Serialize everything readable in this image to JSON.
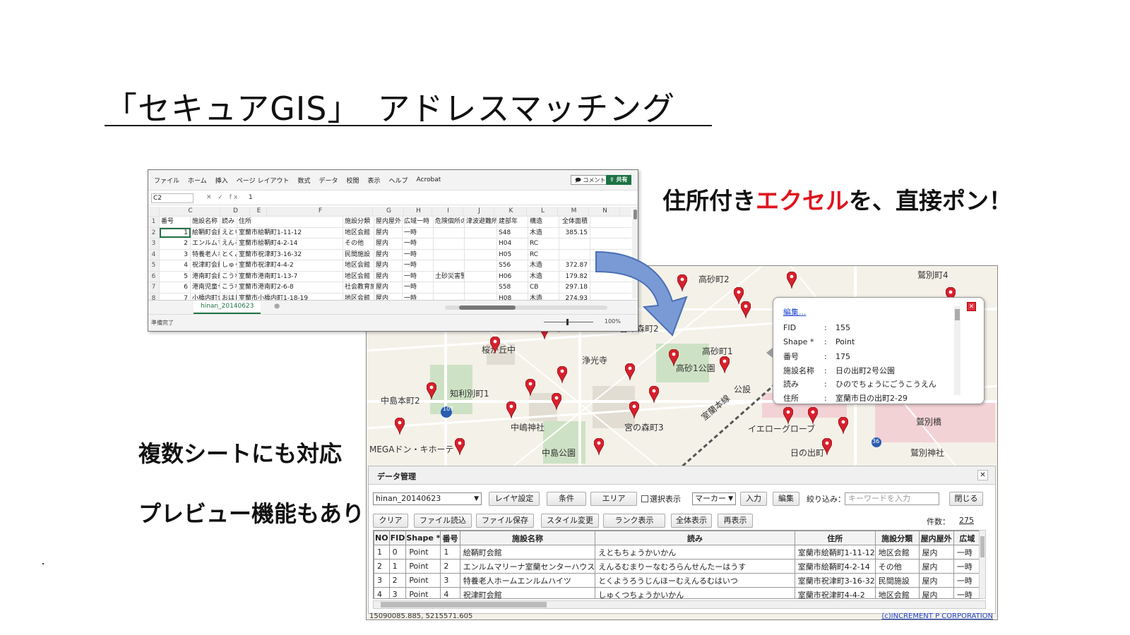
{
  "title": "「セキュアGIS」　アドレスマッチング",
  "caption_right": {
    "prefix": "住所付き",
    "highlight": "エクセル",
    "suffix": "を、直接ポン！"
  },
  "caption_sheets": "複数シートにも対応",
  "caption_preview": "プレビュー機能もあり",
  "colors": {
    "highlight": "#e0141e",
    "excel_green": "#217346",
    "pin_red": "#d8202c",
    "arrow_blue": "#7a9ad6"
  },
  "excel": {
    "menu": [
      "ファイル",
      "ホーム",
      "挿入",
      "ページ レイアウト",
      "数式",
      "データ",
      "校閲",
      "表示",
      "ヘルプ",
      "Acrobat"
    ],
    "comment_label": "コメント",
    "share_label": "共有",
    "name_box": "C2",
    "formula_icons": "✕ ✓ fx",
    "formula_value": "1",
    "col_headers": [
      "C",
      "D",
      "E",
      "F",
      "G",
      "H",
      "I",
      "J",
      "K",
      "L",
      "M",
      "N"
    ],
    "rows": [
      [
        "1",
        "番号",
        "施設名称",
        "読み",
        "住所",
        "施設分類",
        "屋内屋外",
        "広域一時",
        "危険個所の",
        "津波避難所",
        "建部年",
        "構造",
        "全体面積"
      ],
      [
        "2",
        "1",
        "絵鞆町会館",
        "えともちょ",
        "室蘭市絵鞆町1-11-12",
        "地区会館",
        "屋内",
        "一時",
        "",
        "",
        "S48",
        "木造",
        "385.15"
      ],
      [
        "3",
        "2",
        "エンルムマ",
        "えんるむま",
        "室蘭市絵鞆町4-2-14",
        "その他",
        "屋内",
        "一時",
        "",
        "",
        "H04",
        "RC",
        ""
      ],
      [
        "4",
        "3",
        "特養老人ホ",
        "とくようろ",
        "室蘭市祝津町3-16-32",
        "民間施設",
        "屋内",
        "一時",
        "",
        "",
        "H05",
        "RC",
        ""
      ],
      [
        "5",
        "4",
        "祝津町会館",
        "しゅくつち",
        "室蘭市祝津町4-4-2",
        "地区会館",
        "屋内",
        "一時",
        "",
        "",
        "S56",
        "木造",
        "372.87"
      ],
      [
        "6",
        "5",
        "港南町会館",
        "こうなんち",
        "室蘭市港南町1-13-7",
        "地区会館",
        "屋内",
        "一時",
        "土砂災害警",
        "",
        "H06",
        "木造",
        "179.82"
      ],
      [
        "7",
        "6",
        "港南児童セ",
        "こうなんじ",
        "室蘭市港南町2-6-8",
        "社会教育施",
        "屋内",
        "一時",
        "",
        "",
        "S58",
        "CB",
        "297.18"
      ],
      [
        "8",
        "7",
        "小橋内町会",
        "おはしない",
        "室蘭市小橋内町1-18-19",
        "地区会館",
        "屋内",
        "一時",
        "",
        "",
        "H08",
        "木造",
        "274.93"
      ]
    ],
    "sheet_tab": "hinan_20140623",
    "add_sheet": "⊕",
    "status": "準備完了",
    "zoom": "100%"
  },
  "map": {
    "labels": [
      "高砂町2",
      "高砂町1",
      "高砂1公園",
      "宮の森町2",
      "宮の森町3",
      "浄光寺",
      "桜が丘中",
      "知利別町1",
      "中島本町2",
      "中嶋神社",
      "中島公園",
      "MEGAドン・キホーテ",
      "イエローグローブ",
      "鷲別町4",
      "鷲別橋",
      "鷲別神社",
      "日の出町",
      "室蘭本線",
      "公設"
    ],
    "road_badges": [
      "107",
      "36"
    ]
  },
  "popup": {
    "edit_link": "編集...",
    "fields": [
      {
        "key": "FID",
        "value": "155"
      },
      {
        "key": "Shape *",
        "value": "Point"
      },
      {
        "key": "番号",
        "value": "175"
      },
      {
        "key": "施設名称",
        "value": "日の出町2号公園"
      },
      {
        "key": "読み",
        "value": "ひのでちょうにごうこうえん"
      },
      {
        "key": "住所",
        "value": "室蘭市日の出町2-29"
      }
    ]
  },
  "panel": {
    "title": "データ管理",
    "layer_select": "hinan_20140623",
    "toolbar1": [
      "レイヤ設定",
      "条件",
      "エリア"
    ],
    "selection_checkbox": "選択表示",
    "marker_select": "マーカー",
    "toolbar1b": [
      "入力",
      "編集"
    ],
    "filter_label": "絞り込み：",
    "filter_placeholder": "キーワードを入力",
    "close_label": "閉じる",
    "toolbar2": [
      "クリア",
      "ファイル読込",
      "ファイル保存",
      "スタイル変更",
      "ランク表示",
      "全体表示",
      "再表示"
    ],
    "count_label": "件数：",
    "count_value": "275",
    "columns": [
      "NO",
      "FID",
      "Shape *",
      "番号",
      "施設名称",
      "読み",
      "住所",
      "施設分類",
      "屋内屋外",
      "広域"
    ],
    "rows": [
      [
        "1",
        "0",
        "Point",
        "1",
        "絵鞆町会館",
        "えともちょうかいかん",
        "室蘭市絵鞆町1-11-12",
        "地区会館",
        "屋内",
        "一時"
      ],
      [
        "2",
        "1",
        "Point",
        "2",
        "エンルムマリーナ室蘭センターハウス",
        "えんるむまりーなむろらんせんたーはうす",
        "室蘭市絵鞆町4-2-14",
        "その他",
        "屋内",
        "一時"
      ],
      [
        "3",
        "2",
        "Point",
        "3",
        "特養老人ホームエンルムハイツ",
        "とくようろうじんほーむえんるむはいつ",
        "室蘭市祝津町3-16-32",
        "民間施設",
        "屋内",
        "一時"
      ],
      [
        "4",
        "3",
        "Point",
        "4",
        "祝津町会館",
        "しゅくつちょうかいかん",
        "室蘭市祝津町4-4-2",
        "地区会館",
        "屋内",
        "一時"
      ]
    ]
  },
  "footer": {
    "coords": "15090085.885, 5215571.605",
    "copyright": "(c)INCREMENT P CORPORATION"
  }
}
